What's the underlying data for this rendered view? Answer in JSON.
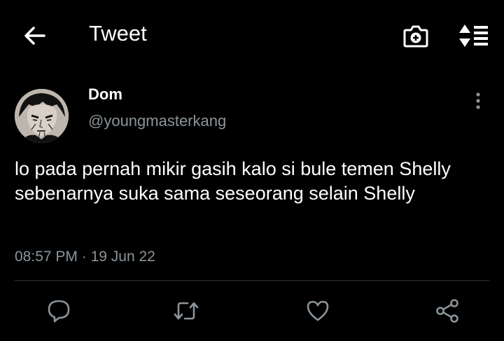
{
  "header": {
    "title": "Tweet",
    "back_icon": "arrow-left-icon",
    "camera_icon": "camera-plus-icon",
    "sort_icon": "sort-list-icon"
  },
  "tweet": {
    "author_name": "Dom",
    "author_handle": "@youngmasterkang",
    "text": "lo pada pernah mikir gasih kalo si bule temen Shelly sebenarnya suka sama seseorang selain Shelly",
    "time": "08:57 PM",
    "separator": "·",
    "date": "19 Jun 22"
  },
  "actions": [
    "reply-icon",
    "retweet-icon",
    "like-icon",
    "share-icon"
  ],
  "colors": {
    "background": "#000000",
    "text": "#ffffff",
    "muted": "#8b949a",
    "divider": "#2f3336"
  }
}
